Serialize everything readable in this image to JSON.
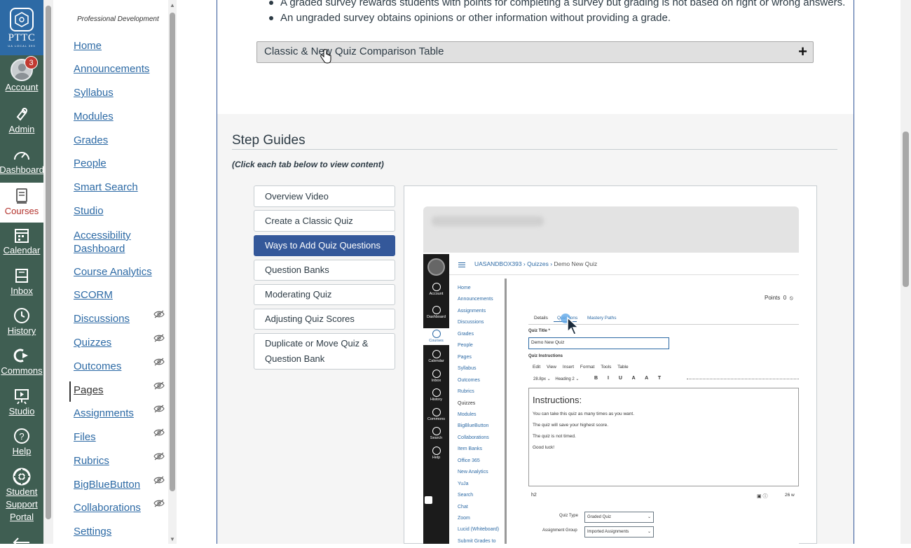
{
  "global_nav": {
    "logo_text": "PTTC",
    "logo_subtext": "UA LOCAL 393",
    "account_badge": "3",
    "items": [
      {
        "label": "Account",
        "icon": "avatar"
      },
      {
        "label": "Admin",
        "icon": "shield-icon"
      },
      {
        "label": "Dashboard",
        "icon": "dashboard-icon"
      },
      {
        "label": "Courses",
        "icon": "book-icon"
      },
      {
        "label": "Calendar",
        "icon": "calendar-icon"
      },
      {
        "label": "Inbox",
        "icon": "inbox-icon"
      },
      {
        "label": "History",
        "icon": "clock-icon"
      },
      {
        "label": "Commons",
        "icon": "commons-icon"
      },
      {
        "label": "Studio",
        "icon": "studio-icon"
      },
      {
        "label": "Help",
        "icon": "help-icon"
      },
      {
        "label": "Student Support Portal",
        "icon": "lifebuoy-icon"
      }
    ],
    "colors": {
      "background": "#3f5e52",
      "logo_bg": "#2d6aa5",
      "active_text": "#b2302a"
    }
  },
  "course_nav": {
    "term": "Professional Development",
    "items": [
      {
        "label": "Home",
        "hidden": false
      },
      {
        "label": "Announcements",
        "hidden": false
      },
      {
        "label": "Syllabus",
        "hidden": false
      },
      {
        "label": "Modules",
        "hidden": false
      },
      {
        "label": "Grades",
        "hidden": false
      },
      {
        "label": "People",
        "hidden": false
      },
      {
        "label": "Smart Search",
        "hidden": false
      },
      {
        "label": "Studio",
        "hidden": false
      },
      {
        "label": "Accessibility Dashboard",
        "hidden": false
      },
      {
        "label": "Course Analytics",
        "hidden": false
      },
      {
        "label": "SCORM",
        "hidden": false
      },
      {
        "label": "Discussions",
        "hidden": true
      },
      {
        "label": "Quizzes",
        "hidden": true
      },
      {
        "label": "Outcomes",
        "hidden": true
      },
      {
        "label": "Pages",
        "hidden": true,
        "active": true
      },
      {
        "label": "Assignments",
        "hidden": true
      },
      {
        "label": "Files",
        "hidden": true
      },
      {
        "label": "Rubrics",
        "hidden": true
      },
      {
        "label": "BigBlueButton",
        "hidden": true
      },
      {
        "label": "Collaborations",
        "hidden": true
      },
      {
        "label": "Settings",
        "hidden": false
      }
    ]
  },
  "content": {
    "bullets": [
      "A graded survey rewards students with points for completing a survey but grading is not based on right or wrong answers.",
      "An ungraded survey obtains opinions or other information without providing a grade."
    ],
    "accordion_label": "Classic & New Quiz Comparison Table",
    "accordion_toggle": "+",
    "step_guides_title": "Step Guides",
    "step_guides_instruction": "(Click each tab below to view content)",
    "tabs": [
      {
        "label": "Overview Video",
        "selected": false
      },
      {
        "label": "Create a Classic Quiz",
        "selected": false
      },
      {
        "label": "Ways to Add Quiz Questions",
        "selected": true
      },
      {
        "label": "Question Banks",
        "selected": false
      },
      {
        "label": "Moderating Quiz",
        "selected": false
      },
      {
        "label": "Adjusting Quiz Scores",
        "selected": false
      },
      {
        "label": "Duplicate or Move Quiz & Question Bank",
        "selected": false
      }
    ]
  },
  "embedded_screenshot": {
    "breadcrumb": [
      "UASANDBOX393",
      "Quizzes",
      "Demo New Quiz"
    ],
    "global_nav": [
      "Account",
      "Dashboard",
      "Courses",
      "Calendar",
      "Inbox",
      "History",
      "Commons",
      "Search",
      "Help"
    ],
    "course_nav": [
      "Home",
      "Announcements",
      "Assignments",
      "Discussions",
      "Grades",
      "People",
      "Pages",
      "Syllabus",
      "Outcomes",
      "Rubrics",
      "Quizzes",
      "Modules",
      "BigBlueButton",
      "Collaborations",
      "Item Banks",
      "Office 365",
      "New Analytics",
      "YuJa",
      "Search",
      "Chat",
      "Zoom",
      "Lucid (Whiteboard)",
      "Submit Grades to"
    ],
    "points_label": "Points",
    "points_value": "0",
    "tabs": [
      "Details",
      "Questions",
      "Mastery Paths"
    ],
    "quiz_title_label": "Quiz Title *",
    "quiz_title_value": "Demo New Quiz",
    "instructions_label": "Quiz Instructions",
    "menu": [
      "Edit",
      "View",
      "Insert",
      "Format",
      "Tools",
      "Table"
    ],
    "font_size": "28.8px",
    "heading": "Heading 2",
    "editor_heading": "Instructions:",
    "editor_lines": [
      "You can take this quiz as many times as you want.",
      "The quiz will save your highest score.",
      "The quiz is not timed.",
      "Good luck!"
    ],
    "status_path": "h2",
    "word_count": "26 w",
    "quiz_type_label": "Quiz Type",
    "quiz_type_value": "Graded Quiz",
    "assignment_group_label": "Assignment Group",
    "assignment_group_value": "Imported Assignments"
  }
}
